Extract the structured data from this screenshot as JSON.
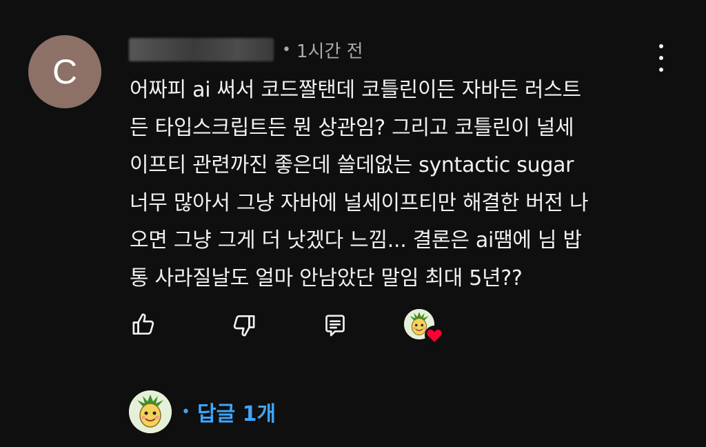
{
  "comment": {
    "author_initial": "C",
    "author_name": "",
    "meta_separator": "•",
    "timestamp": "1시간 전",
    "text_lines": [
      "어짜피 ai 써서 코드짤탠데 코틀린이든 자바든 러스트",
      "든 타입스크립트든 뭔 상관임? 그리고 코틀린이 널세",
      "이프티 관련까진 좋은데 쓸데없는 syntactic sugar",
      "너무 많아서 그냥 자바에 널세이프티만 해결한 버전 나",
      "오면 그냥 그게 더 낫겠다 느낌... 결론은 ai땜에 님 밥",
      "통 사라질날도 얼마 안남았단 말임 최대 5년??"
    ]
  },
  "actions": {
    "like_icon": "thumbs-up-icon",
    "dislike_icon": "thumbs-down-icon",
    "reply_icon": "reply-comment-icon",
    "creator_heart_icon": "heart-icon"
  },
  "replies": {
    "separator": "•",
    "label": "답글 1개"
  },
  "colors": {
    "background": "#0f0f0f",
    "text": "#f1f1f1",
    "secondary_text": "#aaaaaa",
    "link": "#3ea6ff",
    "avatar_bg": "#8d7166",
    "heart": "#ff0033"
  }
}
